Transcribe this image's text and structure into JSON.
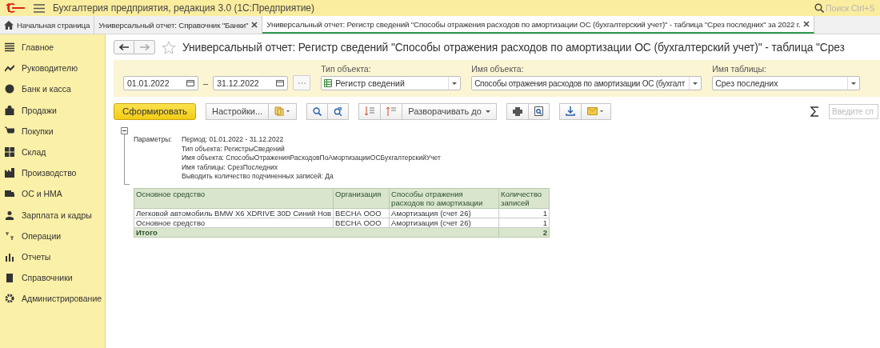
{
  "app": {
    "title": "Бухгалтерия предприятия, редакция 3.0  (1С:Предприятие)",
    "search_placeholder": "Поиск Ctrl+S"
  },
  "tabs": [
    {
      "label": "Начальная страница",
      "selected": false,
      "closable": false
    },
    {
      "label": "Универсальный отчет: Справочник \"Банки\"",
      "selected": false,
      "closable": true
    },
    {
      "label": "Универсальный отчет: Регистр сведений \"Способы отражения расходов по амортизации ОС (бухгалтерский учет)\" - таблица \"Срез последних\" за 2022 г.",
      "selected": true,
      "closable": true
    }
  ],
  "sidebar": {
    "items": [
      {
        "label": "Главное"
      },
      {
        "label": "Руководителю"
      },
      {
        "label": "Банк и касса"
      },
      {
        "label": "Продажи"
      },
      {
        "label": "Покупки"
      },
      {
        "label": "Склад"
      },
      {
        "label": "Производство"
      },
      {
        "label": "ОС и НМА"
      },
      {
        "label": "Зарплата и кадры"
      },
      {
        "label": "Операции"
      },
      {
        "label": "Отчеты"
      },
      {
        "label": "Справочники"
      },
      {
        "label": "Администрирование"
      }
    ]
  },
  "report": {
    "title": "Универсальный отчет: Регистр сведений \"Способы отражения расходов по амортизации ОС (бухгалтерский учет)\" - таблица \"Срез",
    "period": {
      "from": "01.01.2022",
      "to": "31.12.2022",
      "separator": "–"
    },
    "filters": [
      {
        "label": "Тип объекта:",
        "value": "Регистр сведений",
        "kind": "register"
      },
      {
        "label": "Имя объекта:",
        "value": "Способы отражения расходов по амортизации ОС (бухгалт",
        "kind": "plain"
      },
      {
        "label": "Имя таблицы:",
        "value": "Срез последних",
        "kind": "plain"
      }
    ],
    "toolbar": {
      "generate": "Сформировать",
      "settings": "Настройки...",
      "expand": "Разворачивать до",
      "search_placeholder": "Введите сп"
    },
    "parameters": {
      "label": "Параметры:",
      "lines": [
        "Период: 01.01.2022 - 31.12.2022",
        "Тип объекта: РегистрыСведений",
        "Имя объекта: СпособыОтраженияРасходовПоАмортизацииОСБухгалтерскийУчет",
        "Имя таблицы: СрезПоследних",
        "Выводить количество подчиненных записей: Да"
      ]
    },
    "table": {
      "columns": [
        "Основное средство",
        "Организация",
        "Способы отражения расходов по амортизации",
        "Количество записей"
      ],
      "rows": [
        [
          "Легковой автомобиль  BMW X6  XDRIVE 30D Синий Нов",
          "ВЕСНА ООО",
          "Амортизация (счет 26)",
          "1"
        ],
        [
          "Основное средство",
          "ВЕСНА ООО",
          "Амортизация (счет 26)",
          "1"
        ]
      ],
      "total": {
        "label": "Итого",
        "value": "2"
      }
    }
  }
}
